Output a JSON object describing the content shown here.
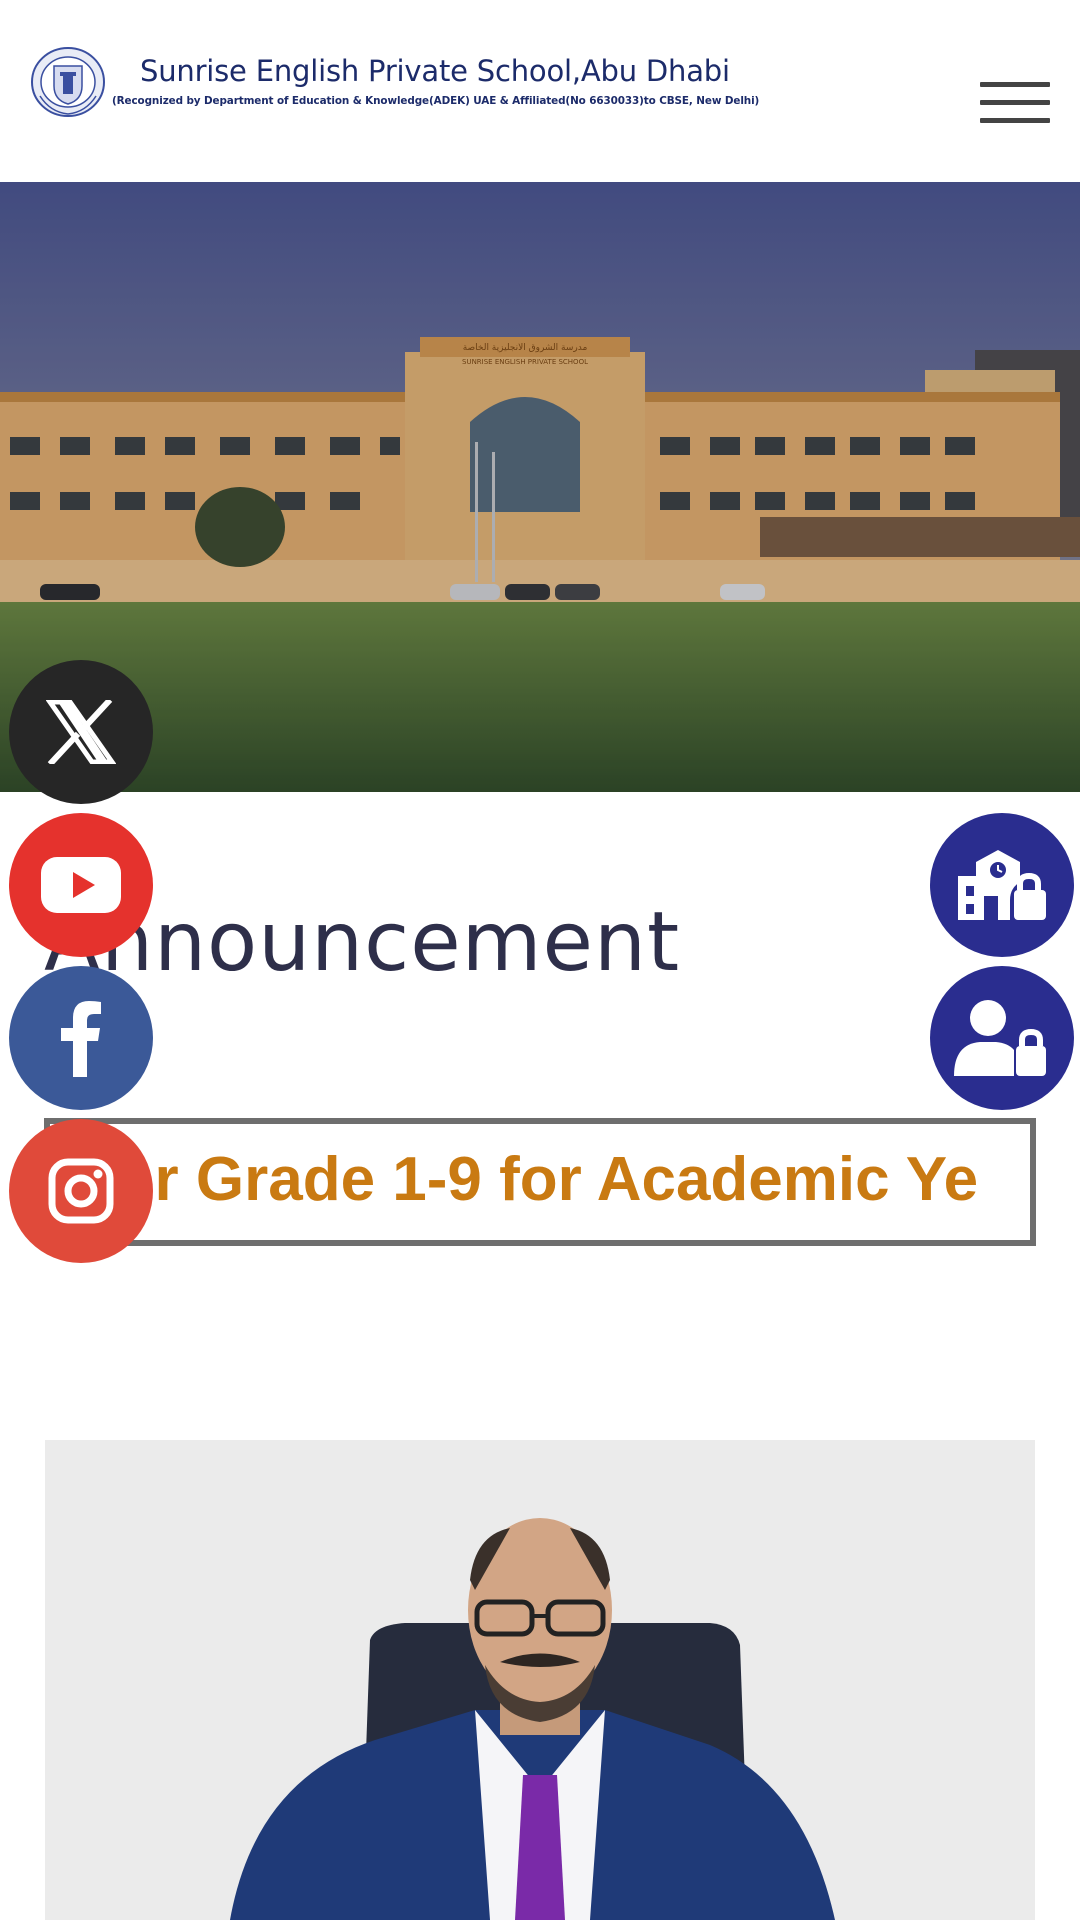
{
  "header": {
    "school_name": "Sunrise English Private School,Abu Dhabi",
    "subtitle": "(Recognized by Department of Education & Knowledge(ADEK) UAE & Affiliated(No 6630033)to CBSE, New Delhi)",
    "logo_icon": "school-crest-icon",
    "menu_icon": "hamburger-menu-icon"
  },
  "hero": {
    "building_sign_arabic": "مدرسة الشروق الانجليزية الخاصة",
    "building_sign_english": "SUNRISE ENGLISH PRIVATE SCHOOL"
  },
  "announcement": {
    "title": "Announcement",
    "ticker_text": "for Grade 1-9 for Academic Ye"
  },
  "social": {
    "x_icon": "x-twitter-icon",
    "youtube_icon": "youtube-icon",
    "facebook_icon": "facebook-icon",
    "instagram_icon": "instagram-icon"
  },
  "portals": {
    "school_login_icon": "school-lock-icon",
    "user_login_icon": "user-lock-icon"
  },
  "colors": {
    "brand_navy": "#1c2b6a",
    "portal_blue": "#2a2d8f",
    "ticker_orange": "#c97a12",
    "x_black": "#262626",
    "youtube_red": "#e5322d",
    "facebook_blue": "#3b5998",
    "instagram_red": "#e04a3a"
  }
}
